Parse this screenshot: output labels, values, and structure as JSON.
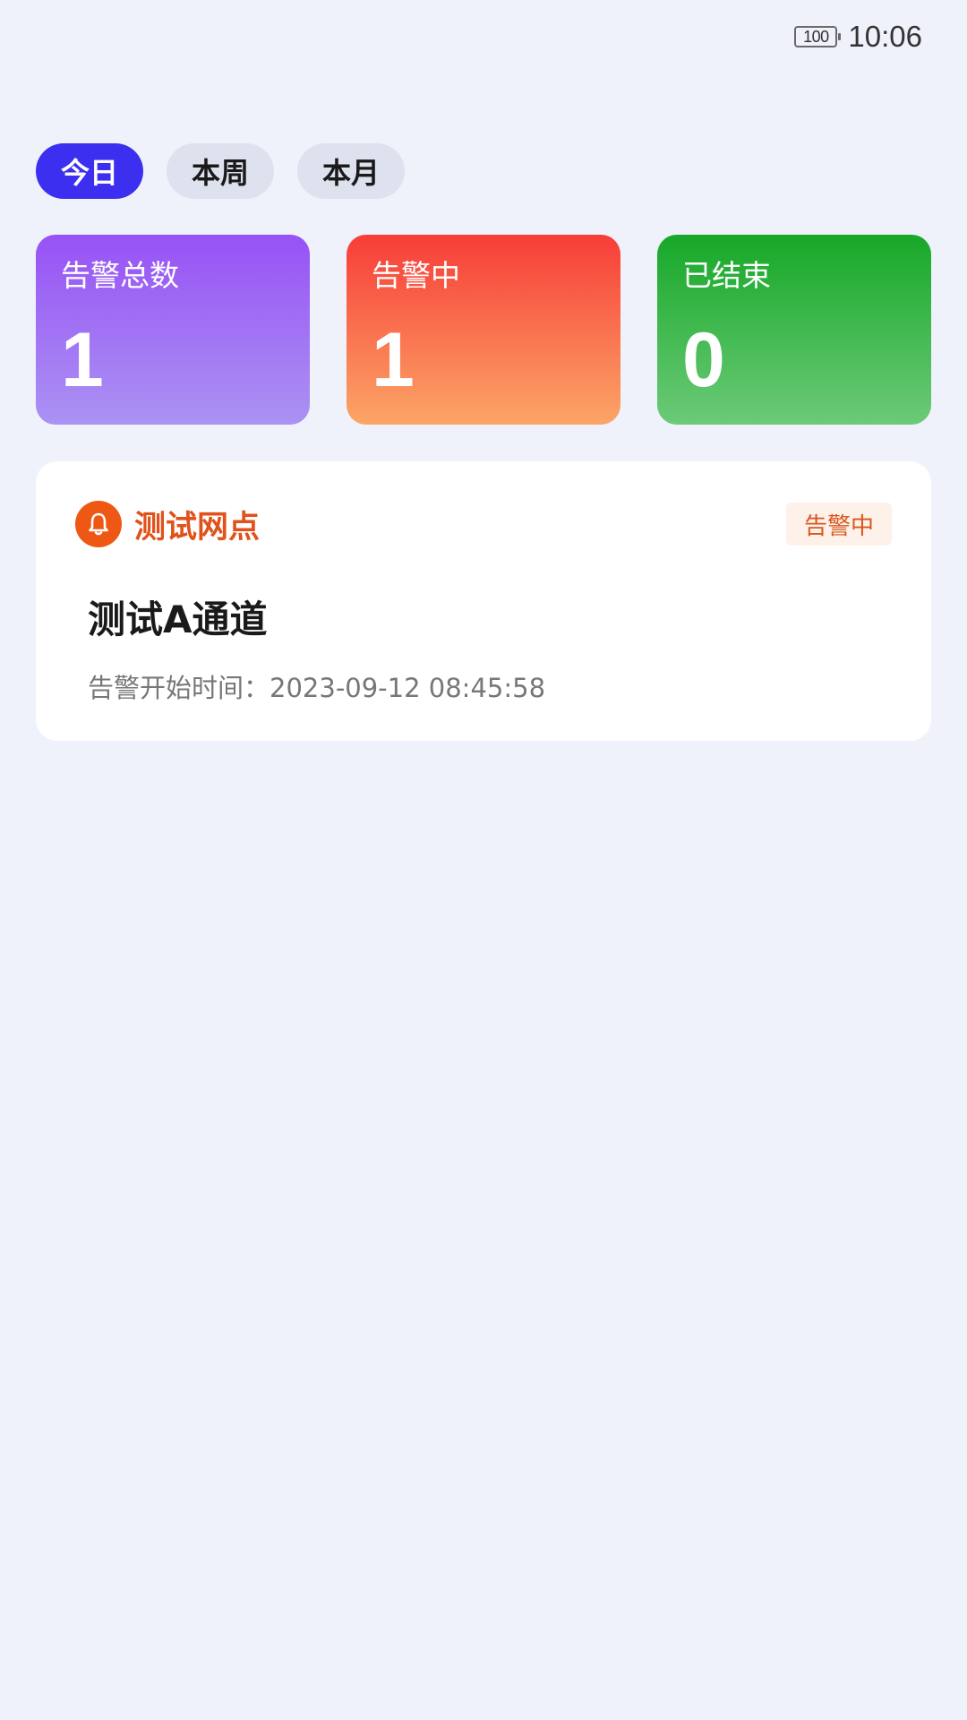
{
  "status_bar": {
    "battery": "100",
    "time": "10:06"
  },
  "period_tabs": [
    {
      "label": "今日",
      "active": true
    },
    {
      "label": "本周",
      "active": false
    },
    {
      "label": "本月",
      "active": false
    }
  ],
  "stats": {
    "total": {
      "label": "告警总数",
      "value": "1"
    },
    "active": {
      "label": "告警中",
      "value": "1"
    },
    "ended": {
      "label": "已结束",
      "value": "0"
    }
  },
  "alarm": {
    "site_name": "测试网点",
    "status": "告警中",
    "channel": "测试A通道",
    "start_time_label": "告警开始时间：",
    "start_time": "2023-09-12 08:45:58"
  },
  "colors": {
    "accent": "#3c2ff0",
    "alarm_orange": "#ee5814",
    "total_card": "#9752f5",
    "active_card": "#f73d38",
    "ended_card": "#17a828",
    "background": "#eff2fb"
  }
}
